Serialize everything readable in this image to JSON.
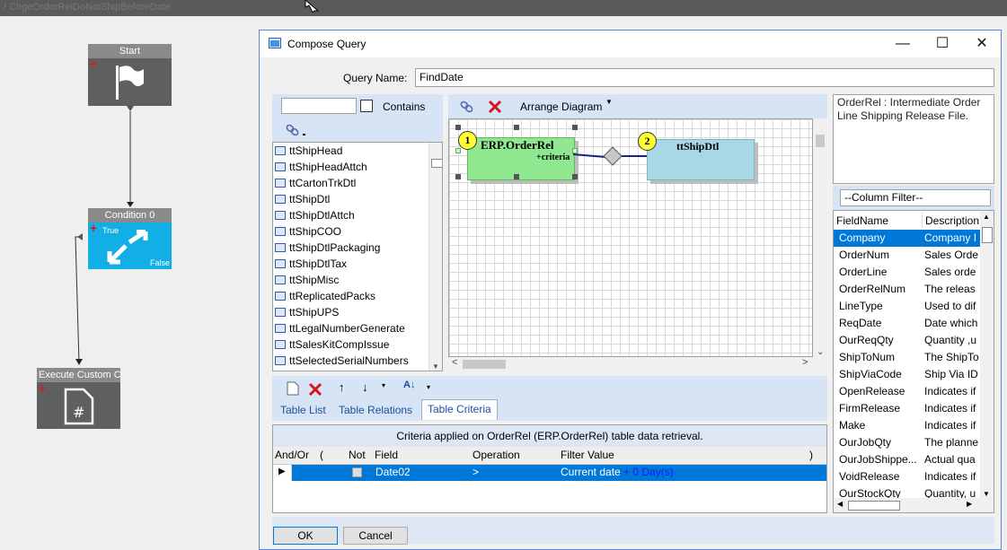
{
  "background": {
    "path_text": "/ ChgeOrderRelDoNotShipBeforeDate",
    "nodes": {
      "start": "Start",
      "condition": "Condition 0",
      "true_label": "True",
      "false_label": "False",
      "execute": "Execute Custom Co"
    }
  },
  "dialog": {
    "title": "Compose Query",
    "minimize": "—",
    "maximize": "☐",
    "close": "✕",
    "query_name_label": "Query Name:",
    "query_name_value": "FindDate",
    "contains_label": "Contains",
    "table_list": [
      "ttShipHead",
      "ttShipHeadAttch",
      "ttCartonTrkDtl",
      "ttShipDtl",
      "ttShipDtlAttch",
      "ttShipCOO",
      "ttShipDtlPackaging",
      "ttShipDtlTax",
      "ttShipMisc",
      "ttReplicatedPacks",
      "ttShipUPS",
      "ttLegalNumberGenerate",
      "ttSalesKitCompIssue",
      "ttSelectedSerialNumbers"
    ],
    "diagram_toolbar": {
      "arrange_label": "Arrange Diagram"
    },
    "diagram": {
      "table1": {
        "number": "1",
        "name": "ERP.OrderRel",
        "criteria": "+criteria"
      },
      "table2": {
        "number": "2",
        "name": "ttShipDtl"
      }
    },
    "description": "OrderRel : Intermediate Order Line Shipping Release File.",
    "column_filter": "--Column Filter--",
    "field_grid": {
      "headers": [
        "FieldName",
        "Description"
      ],
      "rows": [
        [
          "Company",
          "Company I"
        ],
        [
          "OrderNum",
          "Sales Orde"
        ],
        [
          "OrderLine",
          "Sales orde"
        ],
        [
          "OrderRelNum",
          "The releas"
        ],
        [
          "LineType",
          "Used to dif"
        ],
        [
          "ReqDate",
          "Date which"
        ],
        [
          "OurReqQty",
          "Quantity ,u"
        ],
        [
          "ShipToNum",
          "The ShipTo"
        ],
        [
          "ShipViaCode",
          "Ship Via ID"
        ],
        [
          "OpenRelease",
          "Indicates if"
        ],
        [
          "FirmRelease",
          "Indicates if"
        ],
        [
          "Make",
          "Indicates if"
        ],
        [
          "OurJobQty",
          "The planne"
        ],
        [
          "OurJobShippe...",
          "Actual qua"
        ],
        [
          "VoidRelease",
          "Indicates if"
        ],
        [
          "OurStockQty",
          "Quantity, u"
        ]
      ],
      "selected_index": 0
    },
    "tabs": [
      "Table List",
      "Table Relations",
      "Table Criteria"
    ],
    "active_tab": "Table Criteria",
    "criteria": {
      "caption": "Criteria applied on OrderRel (ERP.OrderRel)  table data retrieval.",
      "headers": [
        "And/Or",
        "(",
        "Not",
        "Field",
        "Operation",
        "Filter Value",
        ")"
      ],
      "row": {
        "field": "Date02",
        "operation": ">",
        "filter_value": "Current date",
        "filter_extra": "+ 0 Day(s)"
      }
    },
    "ok_label": "OK",
    "cancel_label": "Cancel"
  },
  "colors": {
    "selection": "#0078d7",
    "orderrel_table": "#90ee90",
    "shipdtl_table": "#add8e6",
    "condition_node": "#12aee6"
  }
}
